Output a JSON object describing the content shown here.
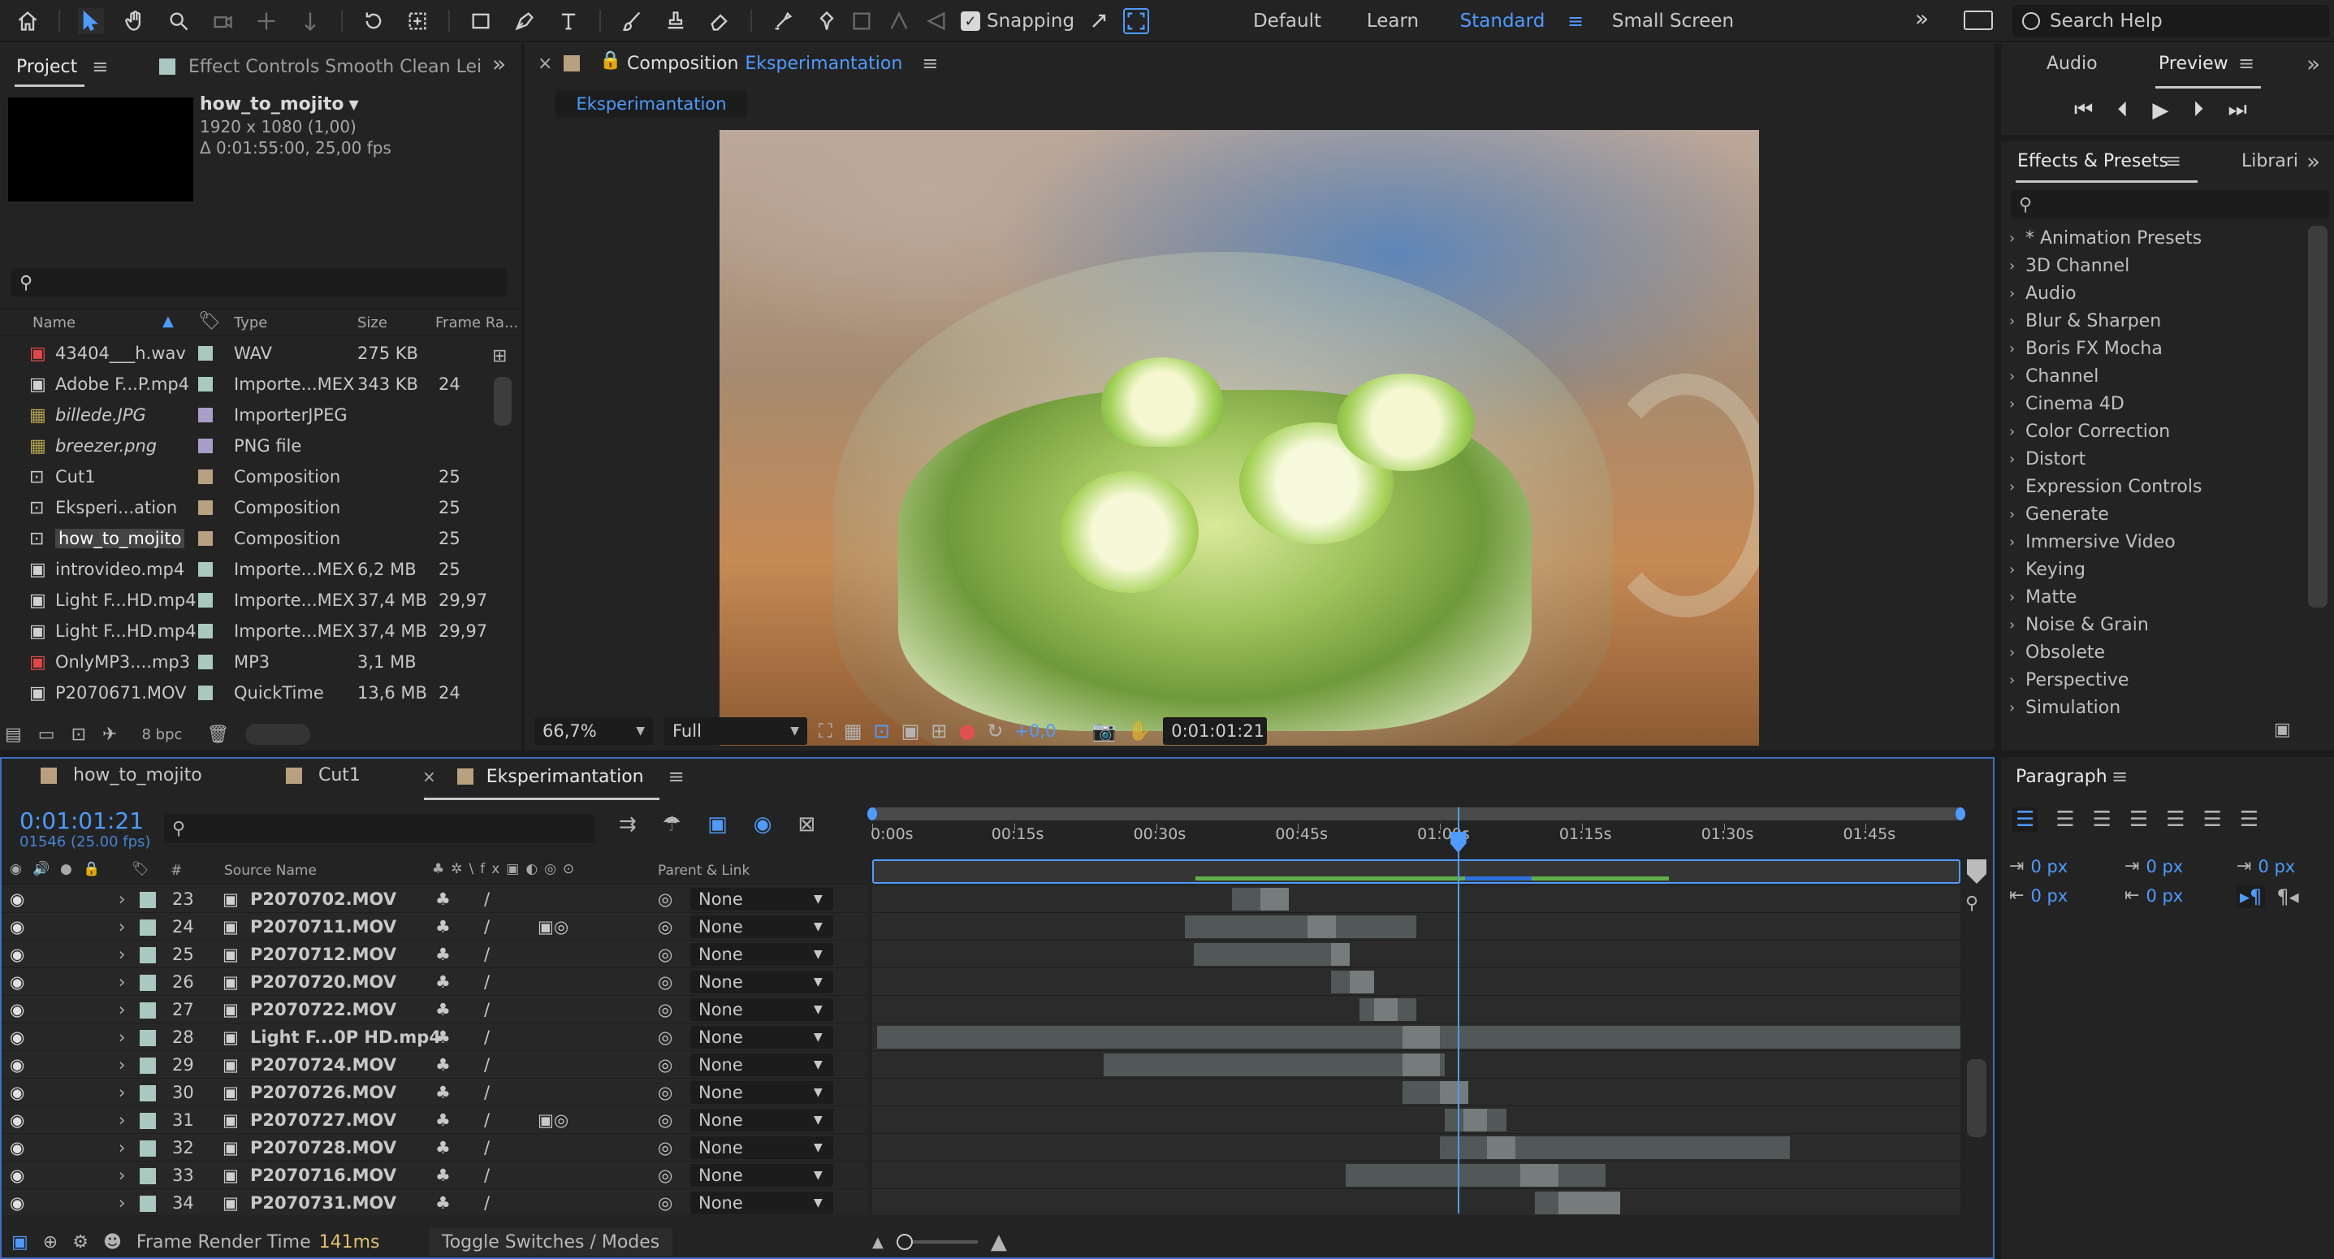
{
  "toolbar": {
    "snapping_label": "Snapping",
    "workspaces": [
      "Default",
      "Learn",
      "Standard",
      "Small Screen"
    ],
    "active_workspace": "Standard",
    "search_placeholder": "Search Help",
    "icons": [
      "home-icon",
      "selection-tool-icon",
      "hand-tool-icon",
      "zoom-tool-icon",
      "orbit-camera-icon",
      "pan-camera-icon",
      "dolly-camera-icon",
      "rotate-tool-icon",
      "anchor-point-tool-icon",
      "rectangle-tool-icon",
      "pen-tool-icon",
      "type-tool-icon",
      "brush-tool-icon",
      "clone-stamp-icon",
      "eraser-icon",
      "roto-brush-icon",
      "puppet-pin-icon"
    ]
  },
  "project": {
    "tab_label": "Project",
    "effect_controls_label": "Effect Controls Smooth Clean Lei",
    "selected_name": "how_to_mojito",
    "selected_dims": "1920 x 1080 (1,00)",
    "selected_duration": "Δ 0:01:55:00, 25,00 fps",
    "search_placeholder": "",
    "columns": [
      "Name",
      "Type",
      "Size",
      "Frame Ra..."
    ],
    "items": [
      {
        "name": "43404___h.wav",
        "type": "WAV",
        "size": "275 KB",
        "fps": "",
        "icon": "audio-file-icon",
        "label_color": "#a8c8c0",
        "italic": false,
        "selected": false
      },
      {
        "name": "Adobe F...P.mp4",
        "type": "Importe...MEX",
        "size": "343 KB",
        "fps": "24",
        "icon": "video-file-icon",
        "label_color": "#a8c8c0",
        "italic": false,
        "selected": false
      },
      {
        "name": "billede.JPG",
        "type": "ImporterJPEG",
        "size": "",
        "fps": "",
        "icon": "image-file-icon",
        "label_color": "#a89ec8",
        "italic": true,
        "selected": false
      },
      {
        "name": "breezer.png",
        "type": "PNG file",
        "size": "",
        "fps": "",
        "icon": "image-file-icon",
        "label_color": "#a89ec8",
        "italic": true,
        "selected": false
      },
      {
        "name": "Cut1",
        "type": "Composition",
        "size": "",
        "fps": "25",
        "icon": "composition-icon",
        "label_color": "#b8a080",
        "italic": false,
        "selected": false
      },
      {
        "name": "Eksperi...ation",
        "type": "Composition",
        "size": "",
        "fps": "25",
        "icon": "composition-icon",
        "label_color": "#b8a080",
        "italic": false,
        "selected": false
      },
      {
        "name": "how_to_mojito",
        "type": "Composition",
        "size": "",
        "fps": "25",
        "icon": "composition-icon",
        "label_color": "#b8a080",
        "italic": false,
        "selected": true
      },
      {
        "name": "introvideo.mp4",
        "type": "Importe...MEX",
        "size": "6,2 MB",
        "fps": "25",
        "icon": "video-file-icon",
        "label_color": "#a8c8c0",
        "italic": false,
        "selected": false
      },
      {
        "name": "Light F...HD.mp4",
        "type": "Importe...MEX",
        "size": "37,4 MB",
        "fps": "29,97",
        "icon": "video-file-icon",
        "label_color": "#a8c8c0",
        "italic": false,
        "selected": false
      },
      {
        "name": "Light F...HD.mp4",
        "type": "Importe...MEX",
        "size": "37,4 MB",
        "fps": "29,97",
        "icon": "video-file-icon",
        "label_color": "#a8c8c0",
        "italic": false,
        "selected": false
      },
      {
        "name": "OnlyMP3....mp3",
        "type": "MP3",
        "size": "3,1 MB",
        "fps": "",
        "icon": "audio-file-icon",
        "label_color": "#a8c8c0",
        "italic": false,
        "selected": false
      },
      {
        "name": "P2070671.MOV",
        "type": "QuickTime",
        "size": "13,6 MB",
        "fps": "24",
        "icon": "video-file-icon",
        "label_color": "#a8c8c0",
        "italic": false,
        "selected": false
      }
    ],
    "bpc_label": "8 bpc"
  },
  "composition": {
    "prefix": "Composition",
    "name": "Eksperimantation",
    "subtab": "Eksperimantation",
    "zoom": "66,7%",
    "resolution": "Full",
    "exposure": "+0,0",
    "timecode": "0:01:01:21"
  },
  "right": {
    "tabs": [
      "Audio",
      "Preview"
    ],
    "active_tab": "Preview",
    "effects_tab": "Effects & Presets",
    "libraries_tab": "Librari",
    "effects_categories": [
      "* Animation Presets",
      "3D Channel",
      "Audio",
      "Blur & Sharpen",
      "Boris FX Mocha",
      "Channel",
      "Cinema 4D",
      "Color Correction",
      "Distort",
      "Expression Controls",
      "Generate",
      "Immersive Video",
      "Keying",
      "Matte",
      "Noise & Grain",
      "Obsolete",
      "Perspective",
      "Simulation"
    ],
    "paragraph_tab": "Paragraph",
    "paragraph_values": [
      "0 px",
      "0 px",
      "0 px",
      "0 px",
      "0 px"
    ]
  },
  "timeline": {
    "tabs": [
      "how_to_mojito",
      "Cut1",
      "Eksperimantation"
    ],
    "active_tab": "Eksperimantation",
    "timecode": "0:01:01:21",
    "frames": "01546 (25.00 fps)",
    "col_source": "Source Name",
    "col_parent": "Parent & Link",
    "col_number": "#",
    "ruler_labels": [
      "0:00s",
      "00:15s",
      "00:30s",
      "00:45s",
      "01:00s",
      "01:15s",
      "01:30s",
      "01:45s"
    ],
    "duration_seconds": 115,
    "playhead_seconds": 61.84,
    "layers": [
      {
        "num": "23",
        "name": "P2070702.MOV",
        "parent": "None",
        "switch_extra": "",
        "bar": [
          38,
          44
        ],
        "bright": [
          41,
          44
        ]
      },
      {
        "num": "24",
        "name": "P2070711.MOV",
        "parent": "None",
        "switch_extra": "motion-blur-icon",
        "bar": [
          33,
          57.5
        ],
        "bright": [
          46,
          49
        ]
      },
      {
        "num": "25",
        "name": "P2070712.MOV",
        "parent": "None",
        "switch_extra": "",
        "bar": [
          34,
          50.5
        ],
        "bright": [
          48.5,
          50.5
        ]
      },
      {
        "num": "26",
        "name": "P2070720.MOV",
        "parent": "None",
        "switch_extra": "",
        "bar": [
          48.5,
          53
        ],
        "bright": [
          50.5,
          53
        ]
      },
      {
        "num": "27",
        "name": "P2070722.MOV",
        "parent": "None",
        "switch_extra": "",
        "bar": [
          51.5,
          57.5
        ],
        "bright": [
          53,
          55.5
        ]
      },
      {
        "num": "28",
        "name": "Light F...0P HD.mp4",
        "parent": "None",
        "switch_extra": "",
        "bar": [
          0.5,
          115
        ],
        "bright": [
          56,
          60
        ]
      },
      {
        "num": "29",
        "name": "P2070724.MOV",
        "parent": "None",
        "switch_extra": "",
        "bar": [
          24.5,
          60.5
        ],
        "bright": [
          56,
          60
        ]
      },
      {
        "num": "30",
        "name": "P2070726.MOV",
        "parent": "None",
        "switch_extra": "",
        "bar": [
          56,
          63
        ],
        "bright": [
          60,
          63
        ]
      },
      {
        "num": "31",
        "name": "P2070727.MOV",
        "parent": "None",
        "switch_extra": "adjustment-motion-icon",
        "bar": [
          60.5,
          67
        ],
        "bright": [
          62.5,
          65
        ]
      },
      {
        "num": "32",
        "name": "P2070728.MOV",
        "parent": "None",
        "switch_extra": "",
        "bar": [
          60,
          97
        ],
        "bright": [
          65,
          68
        ]
      },
      {
        "num": "33",
        "name": "P2070716.MOV",
        "parent": "None",
        "switch_extra": "",
        "bar": [
          50,
          77.5
        ],
        "bright": [
          68.5,
          72.5
        ]
      },
      {
        "num": "34",
        "name": "P2070731.MOV",
        "parent": "None",
        "switch_extra": "",
        "bar": [
          70,
          79
        ],
        "bright": [
          72.5,
          79
        ]
      }
    ],
    "render_time_label": "Frame Render Time",
    "render_time_value": "141ms",
    "toggle_label": "Toggle Switches / Modes"
  },
  "colors": {
    "accent": "#4f9bff",
    "panel": "#232323",
    "bg": "#1b1b1b",
    "work_area": "#5fb04a"
  }
}
